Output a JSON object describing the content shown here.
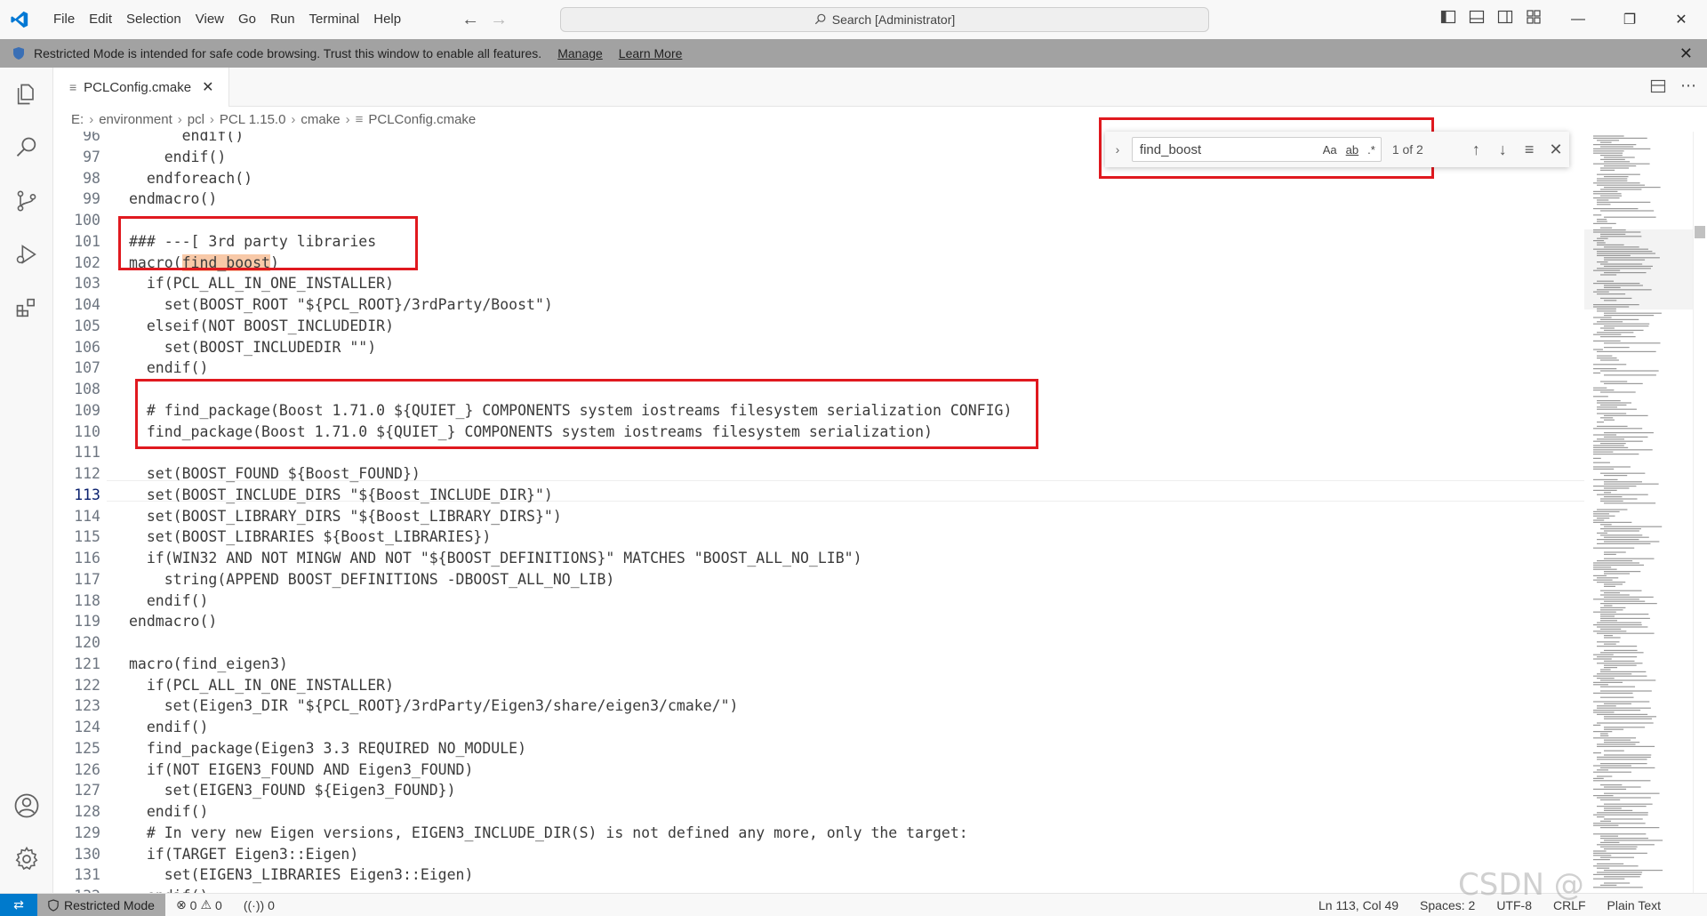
{
  "menu": [
    "File",
    "Edit",
    "Selection",
    "View",
    "Go",
    "Run",
    "Terminal",
    "Help"
  ],
  "command_center": "Search [Administrator]",
  "banner": {
    "text": "Restricted Mode is intended for safe code browsing. Trust this window to enable all features.",
    "manage": "Manage",
    "learn_more": "Learn More"
  },
  "tab": {
    "label": "PCLConfig.cmake"
  },
  "breadcrumb": [
    "E:",
    "environment",
    "pcl",
    "PCL 1.15.0",
    "cmake",
    "PCLConfig.cmake"
  ],
  "find": {
    "query": "find_boost",
    "match_case": "Aa",
    "whole_word": "ab",
    "regex": ".*",
    "count": "1 of 2"
  },
  "lines": [
    {
      "n": "96",
      "text": "      endif()"
    },
    {
      "n": "97",
      "text": "    endif()"
    },
    {
      "n": "98",
      "text": "  endforeach()"
    },
    {
      "n": "99",
      "text": "endmacro()"
    },
    {
      "n": "100",
      "text": ""
    },
    {
      "n": "101",
      "text": "### ---[ 3rd party libraries"
    },
    {
      "n": "102",
      "pre": "macro(",
      "hl": "find_boost",
      "post": ")"
    },
    {
      "n": "103",
      "text": "  if(PCL_ALL_IN_ONE_INSTALLER)"
    },
    {
      "n": "104",
      "text": "    set(BOOST_ROOT \"${PCL_ROOT}/3rdParty/Boost\")"
    },
    {
      "n": "105",
      "text": "  elseif(NOT BOOST_INCLUDEDIR)"
    },
    {
      "n": "106",
      "text": "    set(BOOST_INCLUDEDIR \"\")"
    },
    {
      "n": "107",
      "text": "  endif()"
    },
    {
      "n": "108",
      "text": ""
    },
    {
      "n": "109",
      "text": "  # find_package(Boost 1.71.0 ${QUIET_} COMPONENTS system iostreams filesystem serialization CONFIG)"
    },
    {
      "n": "110",
      "text": "  find_package(Boost 1.71.0 ${QUIET_} COMPONENTS system iostreams filesystem serialization)"
    },
    {
      "n": "111",
      "text": ""
    },
    {
      "n": "112",
      "text": "  set(BOOST_FOUND ${Boost_FOUND})"
    },
    {
      "n": "113",
      "text": "  set(BOOST_INCLUDE_DIRS \"${Boost_INCLUDE_DIR}\")"
    },
    {
      "n": "114",
      "text": "  set(BOOST_LIBRARY_DIRS \"${Boost_LIBRARY_DIRS}\")"
    },
    {
      "n": "115",
      "text": "  set(BOOST_LIBRARIES ${Boost_LIBRARIES})"
    },
    {
      "n": "116",
      "text": "  if(WIN32 AND NOT MINGW AND NOT \"${BOOST_DEFINITIONS}\" MATCHES \"BOOST_ALL_NO_LIB\")"
    },
    {
      "n": "117",
      "text": "    string(APPEND BOOST_DEFINITIONS -DBOOST_ALL_NO_LIB)"
    },
    {
      "n": "118",
      "text": "  endif()"
    },
    {
      "n": "119",
      "text": "endmacro()"
    },
    {
      "n": "120",
      "text": ""
    },
    {
      "n": "121",
      "text": "macro(find_eigen3)"
    },
    {
      "n": "122",
      "text": "  if(PCL_ALL_IN_ONE_INSTALLER)"
    },
    {
      "n": "123",
      "text": "    set(Eigen3_DIR \"${PCL_ROOT}/3rdParty/Eigen3/share/eigen3/cmake/\")"
    },
    {
      "n": "124",
      "text": "  endif()"
    },
    {
      "n": "125",
      "text": "  find_package(Eigen3 3.3 REQUIRED NO_MODULE)"
    },
    {
      "n": "126",
      "text": "  if(NOT EIGEN3_FOUND AND Eigen3_FOUND)"
    },
    {
      "n": "127",
      "text": "    set(EIGEN3_FOUND ${Eigen3_FOUND})"
    },
    {
      "n": "128",
      "text": "  endif()"
    },
    {
      "n": "129",
      "text": "  # In very new Eigen versions, EIGEN3_INCLUDE_DIR(S) is not defined any more, only the target:"
    },
    {
      "n": "130",
      "text": "  if(TARGET Eigen3::Eigen)"
    },
    {
      "n": "131",
      "text": "    set(EIGEN3_LIBRARIES Eigen3::Eigen)"
    },
    {
      "n": "132",
      "text": "  endif()"
    }
  ],
  "status": {
    "restricted": "Restricted Mode",
    "errors": "0",
    "warnings": "0",
    "ports": "0",
    "position": "Ln 113, Col 49",
    "spaces": "Spaces: 2",
    "encoding": "UTF-8",
    "eol": "CRLF",
    "language": "Plain Text"
  },
  "watermark": "CSDN @"
}
